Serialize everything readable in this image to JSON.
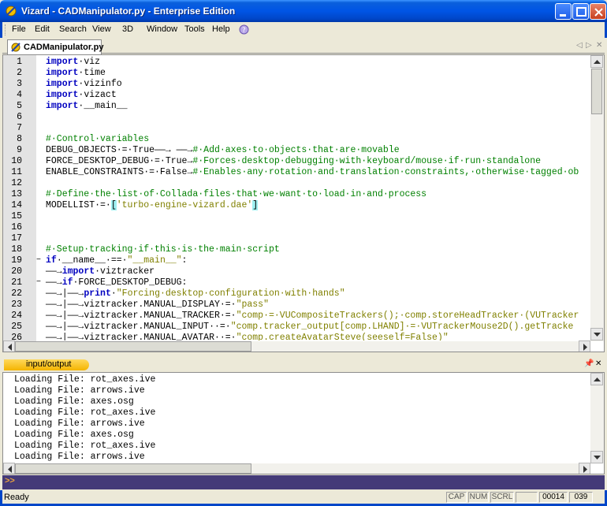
{
  "window": {
    "title": "Vizard - CADManipulator.py - Enterprise Edition"
  },
  "menu": [
    "File",
    "Edit",
    "Search",
    "View",
    "3D",
    "Window",
    "Tools",
    "Help"
  ],
  "tab": {
    "label": "CADManipulator.py"
  },
  "editor": {
    "lines": [
      {
        "n": "1",
        "fold": "",
        "html": "<span class='kw'>import</span>·viz"
      },
      {
        "n": "2",
        "fold": "",
        "html": "<span class='kw'>import</span>·time"
      },
      {
        "n": "3",
        "fold": "",
        "html": "<span class='kw'>import</span>·vizinfo"
      },
      {
        "n": "4",
        "fold": "",
        "html": "<span class='kw'>import</span>·vizact"
      },
      {
        "n": "5",
        "fold": "",
        "html": "<span class='kw'>import</span>·__main__"
      },
      {
        "n": "6",
        "fold": "",
        "html": ""
      },
      {
        "n": "7",
        "fold": "",
        "html": ""
      },
      {
        "n": "8",
        "fold": "",
        "html": "<span class='cm'>#·Control·variables</span>"
      },
      {
        "n": "9",
        "fold": "",
        "html": "DEBUG_OBJECTS·=·True<span class='ar'>——→</span>&nbsp;<span class='ar'>——→</span><span class='cm'>#·Add·axes·to·objects·that·are·movable</span>"
      },
      {
        "n": "10",
        "fold": "",
        "html": "FORCE_DESKTOP_DEBUG·=·True<span class='ar'>→</span><span class='cm'>#·Forces·desktop·debugging·with·keyboard/mouse·if·run·standalone</span>"
      },
      {
        "n": "11",
        "fold": "",
        "html": "ENABLE_CONSTRAINTS·=·False<span class='ar'>→</span><span class='cm'>#·Enables·any·rotation·and·translation·constraints,·otherwise·tagged·ob</span>"
      },
      {
        "n": "12",
        "fold": "",
        "html": ""
      },
      {
        "n": "13",
        "fold": "",
        "html": "<span class='cm'>#·Define·the·list·of·Collada·files·that·we·want·to·load·in·and·process</span>"
      },
      {
        "n": "14",
        "fold": "",
        "html": "MODELLIST·=·<span class='hl'>[</span><span class='st'>'turbo-engine-vizard.dae'</span><span class='hl'>]</span>"
      },
      {
        "n": "15",
        "fold": "",
        "html": ""
      },
      {
        "n": "16",
        "fold": "",
        "html": ""
      },
      {
        "n": "17",
        "fold": "",
        "html": ""
      },
      {
        "n": "18",
        "fold": "",
        "html": "<span class='cm'>#·Setup·tracking·if·this·is·the·main·script</span>"
      },
      {
        "n": "19",
        "fold": "-",
        "html": "<span class='kw'>if</span>·__name__·==·<span class='st'>\"__main__\"</span>:"
      },
      {
        "n": "20",
        "fold": "",
        "html": "<span class='ar'>——→</span><span class='kw'>import</span>·viztracker"
      },
      {
        "n": "21",
        "fold": "-",
        "html": "<span class='ar'>——→</span><span class='kw'>if</span>·FORCE_DESKTOP_DEBUG:"
      },
      {
        "n": "22",
        "fold": "",
        "html": "<span class='ar'>——→</span>|<span class='ar'>——→</span><span class='kw'>print</span>·<span class='st'>\"Forcing·desktop·configuration·with·hands\"</span>"
      },
      {
        "n": "23",
        "fold": "",
        "html": "<span class='ar'>——→</span>|<span class='ar'>——→</span>viztracker.MANUAL_DISPLAY·=·<span class='st'>\"pass\"</span>"
      },
      {
        "n": "24",
        "fold": "",
        "html": "<span class='ar'>——→</span>|<span class='ar'>——→</span>viztracker.MANUAL_TRACKER·=·<span class='st'>\"comp·=·VUCompositeTrackers();·comp.storeHeadTracker·(VUTracker</span>"
      },
      {
        "n": "25",
        "fold": "",
        "html": "<span class='ar'>——→</span>|<span class='ar'>——→</span>viztracker.MANUAL_INPUT··=·<span class='st'>\"comp.tracker_output[comp.LHAND]·=·VUTrackerMouse2D().getTracke</span>"
      },
      {
        "n": "26",
        "fold": "",
        "html": "<span class='ar'>——→</span>|<span class='ar'>——→</span>viztracker.MANUAL_AVATAR··=·<span class='st'>\"comp.createAvatarSteve(seeself=False)\"</span>"
      }
    ]
  },
  "output": {
    "title": "input/output",
    "lines": [
      "Loading File: rot_axes.ive",
      "Loading File: arrows.ive",
      "Loading File: axes.osg",
      "Loading File: rot_axes.ive",
      "Loading File: arrows.ive",
      "Loading File: axes.osg",
      "Loading File: rot_axes.ive",
      "Loading File: arrows.ive"
    ]
  },
  "command": {
    "prompt": ">>"
  },
  "status": {
    "text": "Ready",
    "caps": "CAP",
    "num": "NUM",
    "scrl": "SCRL",
    "line": "00014",
    "col": "039"
  },
  "colors": {
    "titlebar": "#0055e5",
    "gutter": "#e3e3e3",
    "keyword": "#0000c0",
    "comment": "#008000",
    "string": "#808000",
    "output_tab": "#f4b400",
    "command_bar": "#443a78"
  }
}
